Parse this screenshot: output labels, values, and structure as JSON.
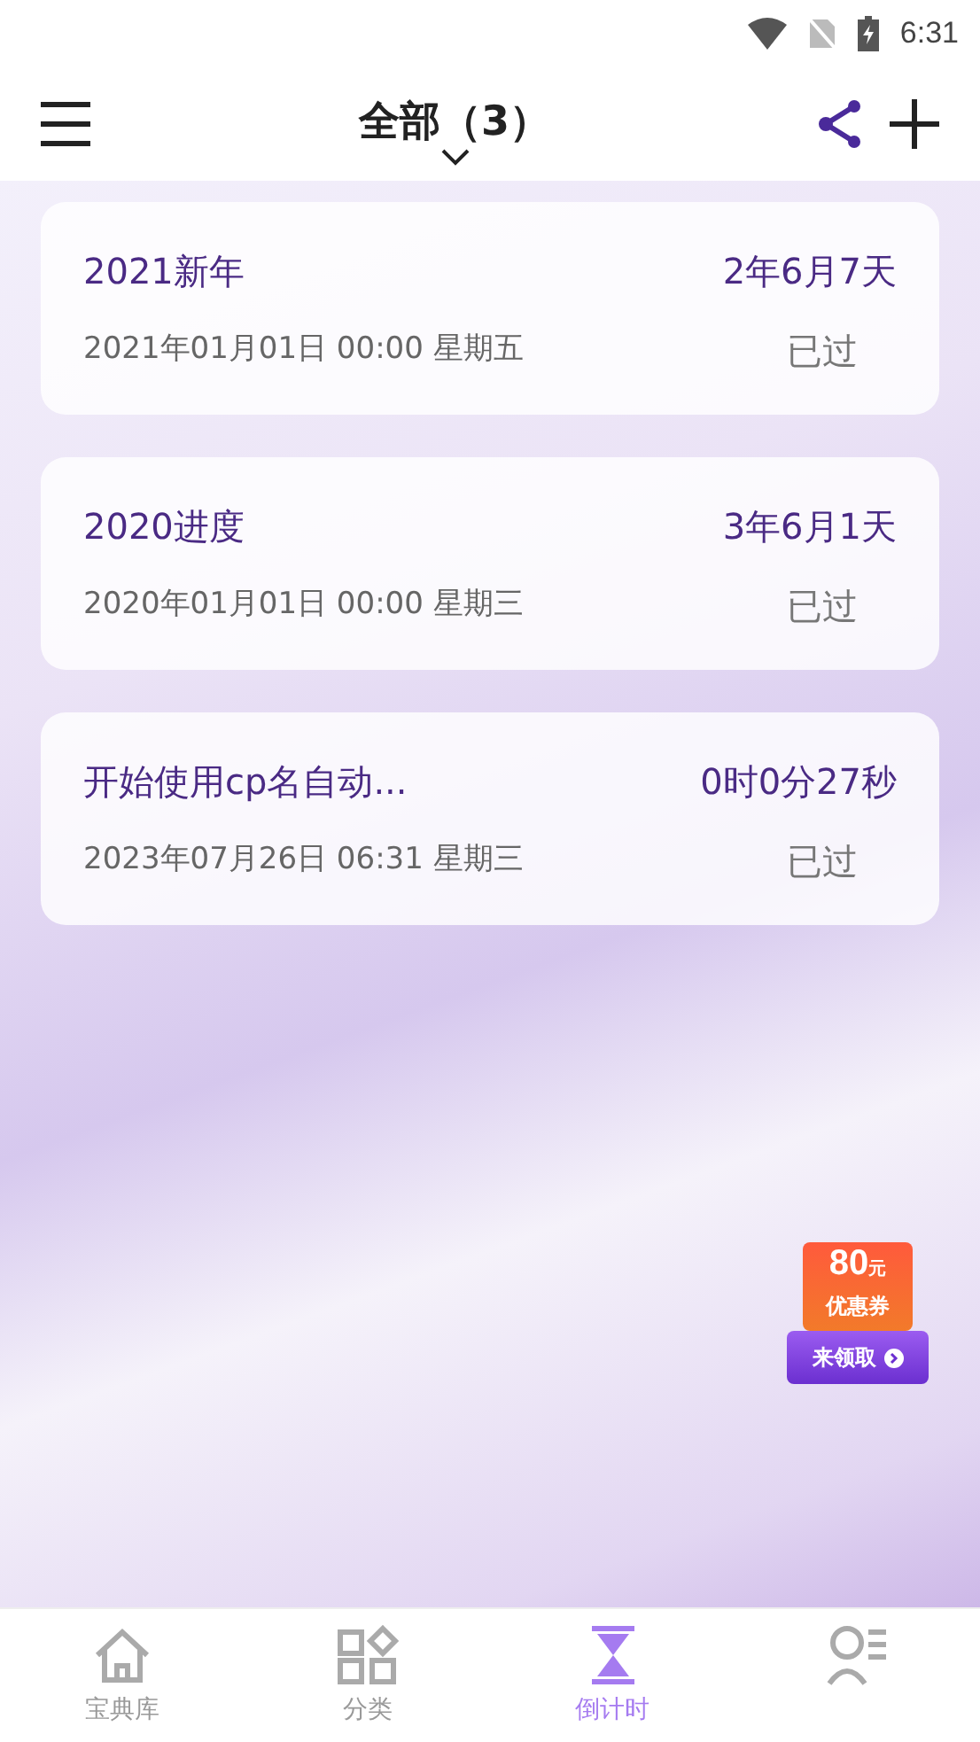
{
  "status_bar": {
    "time": "6:31"
  },
  "header": {
    "title": "全部（3）"
  },
  "events": [
    {
      "name": "2021新年",
      "elapsed": "2年6月7天",
      "date": "2021年01月01日 00:00 星期五",
      "status": "已过"
    },
    {
      "name": "2020进度",
      "elapsed": "3年6月1天",
      "date": "2020年01月01日 00:00 星期三",
      "status": "已过"
    },
    {
      "name": "开始使用cp名自动...",
      "elapsed": "0时0分27秒",
      "date": "2023年07月26日 06:31 星期三",
      "status": "已过"
    }
  ],
  "coupon": {
    "amount": "80",
    "unit": "元",
    "label": "优惠券",
    "action": "来领取"
  },
  "tabs": [
    {
      "kind": "home",
      "label": "宝典库",
      "selected": false
    },
    {
      "kind": "grid",
      "label": "分类",
      "selected": false
    },
    {
      "kind": "hourglass",
      "label": "倒计时",
      "selected": true
    },
    {
      "kind": "profile",
      "selected": false
    }
  ]
}
